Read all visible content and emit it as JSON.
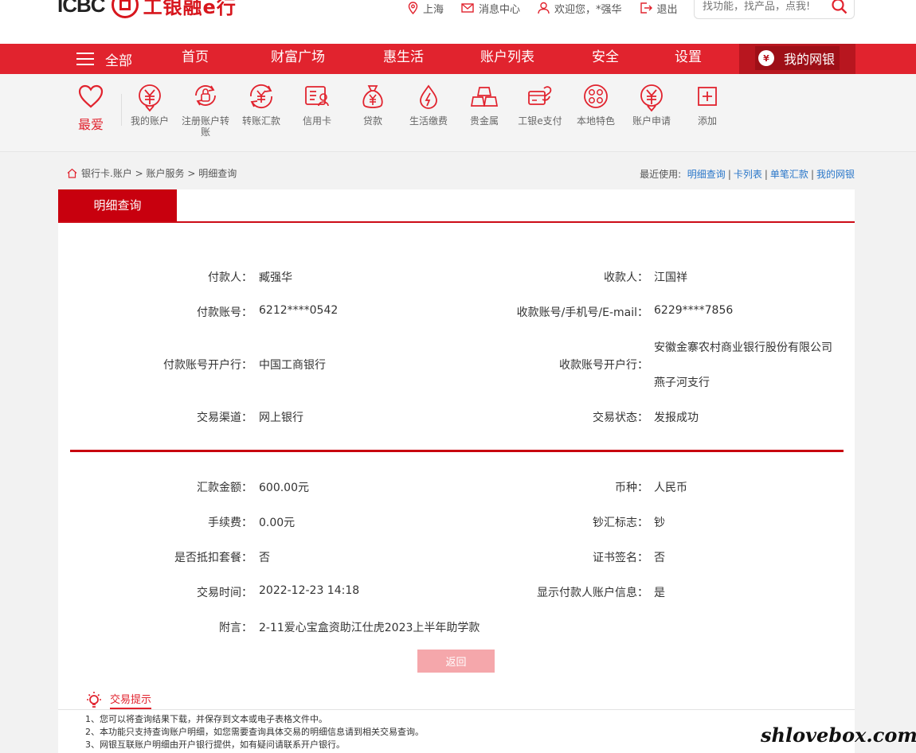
{
  "header": {
    "logo_text": "ICBC",
    "brand_text": "工银融e行",
    "location": "上海",
    "message_center": "消息中心",
    "welcome": "欢迎您，*强华",
    "logout": "退出",
    "search_placeholder": "找功能，找产品，点我!"
  },
  "nav": {
    "all": "全部",
    "items": [
      "首页",
      "财富广场",
      "惠生活",
      "账户列表",
      "安全",
      "设置"
    ],
    "my_bank": "我的网银"
  },
  "quick": {
    "favorite": "最爱",
    "items": [
      {
        "label": "我的账户",
        "icon": "yuan-circle-icon"
      },
      {
        "label": "注册账户转账",
        "icon": "transfer-lock-icon"
      },
      {
        "label": "转账汇款",
        "icon": "remit-icon"
      },
      {
        "label": "信用卡",
        "icon": "credit-card-icon"
      },
      {
        "label": "贷款",
        "icon": "loan-bag-icon"
      },
      {
        "label": "生活缴费",
        "icon": "utility-icon"
      },
      {
        "label": "贵金属",
        "icon": "gold-bars-icon"
      },
      {
        "label": "工银e支付",
        "icon": "epay-icon"
      },
      {
        "label": "本地特色",
        "icon": "local-icon"
      },
      {
        "label": "账户申请",
        "icon": "account-apply-icon"
      },
      {
        "label": "添加",
        "icon": "add-icon"
      }
    ]
  },
  "breadcrumb": [
    "银行卡.账户",
    "账户服务",
    "明细查询"
  ],
  "recent": {
    "label": "最近使用:",
    "links": [
      "明细查询",
      "卡列表",
      "单笔汇款",
      "我的网银"
    ]
  },
  "tab": "明细查询",
  "detail": {
    "payer_label": "付款人：",
    "payer": "臧强华",
    "payee_label": "收款人：",
    "payee": "江国祥",
    "payer_acct_label": "付款账号：",
    "payer_acct": "6212****0542",
    "payee_acct_label": "收款账号/手机号/E-mail：",
    "payee_acct": "6229****7856",
    "payer_bank_label": "付款账号开户行：",
    "payer_bank": "中国工商银行",
    "payee_bank_label": "收款账号开户行：",
    "payee_bank_1": "安徽金寨农村商业银行股份有限公司",
    "payee_bank_2": "燕子河支行",
    "channel_label": "交易渠道：",
    "channel": "网上银行",
    "status_label": "交易状态：",
    "status": "发报成功",
    "amount_label": "汇款金额：",
    "amount": "600.00元",
    "currency_label": "币种：",
    "currency": "人民币",
    "fee_label": "手续费：",
    "fee": "0.00元",
    "cash_flag_label": "钞汇标志：",
    "cash_flag": "钞",
    "package_label": "是否抵扣套餐：",
    "package": "否",
    "cert_label": "证书签名：",
    "cert": "否",
    "time_label": "交易时间：",
    "time": "2022-12-23 14:18",
    "show_payer_label": "显示付款人账户信息：",
    "show_payer": "是",
    "note_label": "附言：",
    "note": "2-11爱心宝盒资助江仕虎2023上半年助学款"
  },
  "back_button": "返回",
  "tips": {
    "title": "交易提示",
    "items": [
      "1、您可以将查询结果下载，并保存到文本或电子表格文件中。",
      "2、本功能只支持查询账户明细，如您需要查询具体交易的明细信息请到相关交易查询。",
      "3、网银互联账户明细由开户银行提供，如有疑问请联系开户银行。"
    ]
  },
  "watermark": "shlovebox.com",
  "colors": {
    "brand_red": "#e1232e",
    "dark_red": "#c8000e",
    "link_blue": "#2a77c9"
  }
}
